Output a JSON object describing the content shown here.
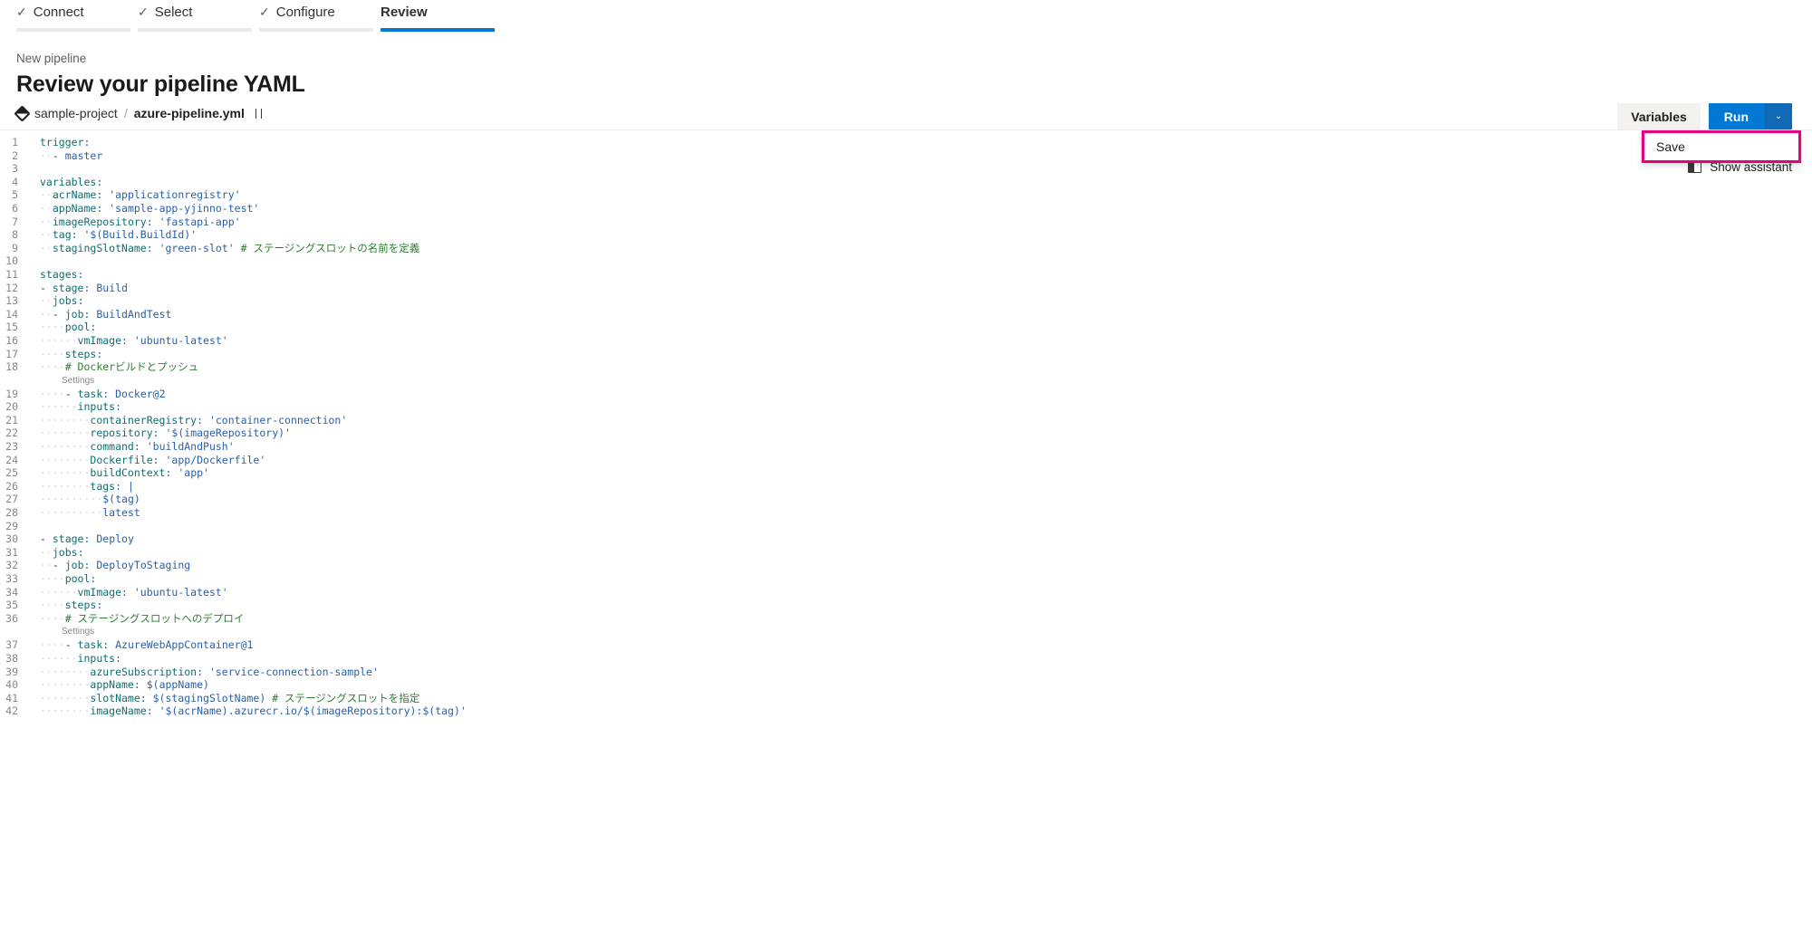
{
  "wizard": {
    "tabs": [
      {
        "label": "Connect",
        "completed": true,
        "active": false,
        "check": "✓"
      },
      {
        "label": "Select",
        "completed": true,
        "active": false,
        "check": "✓"
      },
      {
        "label": "Configure",
        "completed": true,
        "active": false,
        "check": "✓"
      },
      {
        "label": "Review",
        "completed": false,
        "active": true,
        "check": ""
      }
    ]
  },
  "header": {
    "eyebrow": "New pipeline",
    "title": "Review your pipeline YAML"
  },
  "commandbar": {
    "variables_label": "Variables",
    "run_label": "Run",
    "caret_glyph": "⌄",
    "accent_color": "#0078d4"
  },
  "dropdown": {
    "items": [
      {
        "label": "Save"
      }
    ],
    "highlight_color": "#e4007f"
  },
  "assistant": {
    "label": "Show assistant",
    "icon": "panel-icon"
  },
  "breadcrumb": {
    "project": "sample-project",
    "separator": "/",
    "file": "azure-pipeline.yml"
  },
  "editor": {
    "codelens_label": "Settings",
    "lines": [
      {
        "n": 1,
        "segments": [
          {
            "t": "key",
            "s": "trigger"
          },
          {
            "t": "punc",
            "s": ":"
          }
        ]
      },
      {
        "n": 2,
        "segments": [
          {
            "t": "ind",
            "s": "··"
          },
          {
            "t": "dash",
            "s": "- "
          },
          {
            "t": "val",
            "s": "master"
          }
        ]
      },
      {
        "n": 3,
        "segments": []
      },
      {
        "n": 4,
        "segments": [
          {
            "t": "key",
            "s": "variables"
          },
          {
            "t": "punc",
            "s": ":"
          }
        ]
      },
      {
        "n": 5,
        "segments": [
          {
            "t": "ind",
            "s": "··"
          },
          {
            "t": "key",
            "s": "acrName"
          },
          {
            "t": "punc",
            "s": ": "
          },
          {
            "t": "str",
            "s": "'applicationregistry'"
          }
        ]
      },
      {
        "n": 6,
        "segments": [
          {
            "t": "ind",
            "s": "··"
          },
          {
            "t": "key",
            "s": "appName"
          },
          {
            "t": "punc",
            "s": ": "
          },
          {
            "t": "str",
            "s": "'sample-app-yjinno-test'"
          }
        ]
      },
      {
        "n": 7,
        "segments": [
          {
            "t": "ind",
            "s": "··"
          },
          {
            "t": "key",
            "s": "imageRepository"
          },
          {
            "t": "punc",
            "s": ": "
          },
          {
            "t": "str",
            "s": "'fastapi-app'"
          }
        ]
      },
      {
        "n": 8,
        "segments": [
          {
            "t": "ind",
            "s": "··"
          },
          {
            "t": "key",
            "s": "tag"
          },
          {
            "t": "punc",
            "s": ": "
          },
          {
            "t": "str",
            "s": "'$(Build.BuildId)'"
          }
        ]
      },
      {
        "n": 9,
        "segments": [
          {
            "t": "ind",
            "s": "··"
          },
          {
            "t": "key",
            "s": "stagingSlotName"
          },
          {
            "t": "punc",
            "s": ": "
          },
          {
            "t": "str",
            "s": "'green-slot'"
          },
          {
            "t": "cmt",
            "s": " # ステージングスロットの名前を定義"
          }
        ]
      },
      {
        "n": 10,
        "segments": []
      },
      {
        "n": 11,
        "segments": [
          {
            "t": "key",
            "s": "stages"
          },
          {
            "t": "punc",
            "s": ":"
          }
        ]
      },
      {
        "n": 12,
        "segments": [
          {
            "t": "dash",
            "s": "- "
          },
          {
            "t": "key",
            "s": "stage"
          },
          {
            "t": "punc",
            "s": ": "
          },
          {
            "t": "val",
            "s": "Build"
          }
        ]
      },
      {
        "n": 13,
        "segments": [
          {
            "t": "ind",
            "s": "··"
          },
          {
            "t": "key",
            "s": "jobs"
          },
          {
            "t": "punc",
            "s": ":"
          }
        ]
      },
      {
        "n": 14,
        "segments": [
          {
            "t": "ind",
            "s": "··"
          },
          {
            "t": "dash",
            "s": "- "
          },
          {
            "t": "key",
            "s": "job"
          },
          {
            "t": "punc",
            "s": ": "
          },
          {
            "t": "val",
            "s": "BuildAndTest"
          }
        ]
      },
      {
        "n": 15,
        "segments": [
          {
            "t": "ind",
            "s": "····"
          },
          {
            "t": "key",
            "s": "pool"
          },
          {
            "t": "punc",
            "s": ":"
          }
        ]
      },
      {
        "n": 16,
        "segments": [
          {
            "t": "ind",
            "s": "······"
          },
          {
            "t": "key",
            "s": "vmImage"
          },
          {
            "t": "punc",
            "s": ": "
          },
          {
            "t": "str",
            "s": "'ubuntu-latest'"
          }
        ]
      },
      {
        "n": 17,
        "segments": [
          {
            "t": "ind",
            "s": "····"
          },
          {
            "t": "key",
            "s": "steps"
          },
          {
            "t": "punc",
            "s": ":"
          }
        ]
      },
      {
        "n": 18,
        "segments": [
          {
            "t": "ind",
            "s": "····"
          },
          {
            "t": "cmt",
            "s": "# Dockerビルドとプッシュ"
          }
        ],
        "codelens": true
      },
      {
        "n": 19,
        "segments": [
          {
            "t": "ind",
            "s": "····"
          },
          {
            "t": "dash",
            "s": "- "
          },
          {
            "t": "key",
            "s": "task"
          },
          {
            "t": "punc",
            "s": ": "
          },
          {
            "t": "val",
            "s": "Docker@2"
          }
        ]
      },
      {
        "n": 20,
        "segments": [
          {
            "t": "ind",
            "s": "······"
          },
          {
            "t": "key",
            "s": "inputs"
          },
          {
            "t": "punc",
            "s": ":"
          }
        ]
      },
      {
        "n": 21,
        "segments": [
          {
            "t": "ind",
            "s": "········"
          },
          {
            "t": "key",
            "s": "containerRegistry"
          },
          {
            "t": "punc",
            "s": ": "
          },
          {
            "t": "str",
            "s": "'container-connection'"
          }
        ]
      },
      {
        "n": 22,
        "segments": [
          {
            "t": "ind",
            "s": "········"
          },
          {
            "t": "key",
            "s": "repository"
          },
          {
            "t": "punc",
            "s": ": "
          },
          {
            "t": "str",
            "s": "'$(imageRepository)'"
          }
        ]
      },
      {
        "n": 23,
        "segments": [
          {
            "t": "ind",
            "s": "········"
          },
          {
            "t": "key",
            "s": "command"
          },
          {
            "t": "punc",
            "s": ": "
          },
          {
            "t": "str",
            "s": "'buildAndPush'"
          }
        ]
      },
      {
        "n": 24,
        "segments": [
          {
            "t": "ind",
            "s": "········"
          },
          {
            "t": "key",
            "s": "Dockerfile"
          },
          {
            "t": "punc",
            "s": ": "
          },
          {
            "t": "str",
            "s": "'app/Dockerfile'"
          }
        ]
      },
      {
        "n": 25,
        "segments": [
          {
            "t": "ind",
            "s": "········"
          },
          {
            "t": "key",
            "s": "buildContext"
          },
          {
            "t": "punc",
            "s": ": "
          },
          {
            "t": "str",
            "s": "'app'"
          }
        ]
      },
      {
        "n": 26,
        "segments": [
          {
            "t": "ind",
            "s": "········"
          },
          {
            "t": "key",
            "s": "tags"
          },
          {
            "t": "punc",
            "s": ": "
          },
          {
            "t": "val",
            "s": "|"
          }
        ]
      },
      {
        "n": 27,
        "segments": [
          {
            "t": "ind",
            "s": "··········"
          },
          {
            "t": "val",
            "s": "$(tag)"
          }
        ]
      },
      {
        "n": 28,
        "segments": [
          {
            "t": "ind",
            "s": "··········"
          },
          {
            "t": "val",
            "s": "latest"
          }
        ]
      },
      {
        "n": 29,
        "segments": []
      },
      {
        "n": 30,
        "segments": [
          {
            "t": "dash",
            "s": "- "
          },
          {
            "t": "key",
            "s": "stage"
          },
          {
            "t": "punc",
            "s": ": "
          },
          {
            "t": "val",
            "s": "Deploy"
          }
        ]
      },
      {
        "n": 31,
        "segments": [
          {
            "t": "ind",
            "s": "··"
          },
          {
            "t": "key",
            "s": "jobs"
          },
          {
            "t": "punc",
            "s": ":"
          }
        ]
      },
      {
        "n": 32,
        "segments": [
          {
            "t": "ind",
            "s": "··"
          },
          {
            "t": "dash",
            "s": "- "
          },
          {
            "t": "key",
            "s": "job"
          },
          {
            "t": "punc",
            "s": ": "
          },
          {
            "t": "val",
            "s": "DeployToStaging"
          }
        ]
      },
      {
        "n": 33,
        "segments": [
          {
            "t": "ind",
            "s": "····"
          },
          {
            "t": "key",
            "s": "pool"
          },
          {
            "t": "punc",
            "s": ":"
          }
        ]
      },
      {
        "n": 34,
        "segments": [
          {
            "t": "ind",
            "s": "······"
          },
          {
            "t": "key",
            "s": "vmImage"
          },
          {
            "t": "punc",
            "s": ": "
          },
          {
            "t": "str",
            "s": "'ubuntu-latest'"
          }
        ]
      },
      {
        "n": 35,
        "segments": [
          {
            "t": "ind",
            "s": "····"
          },
          {
            "t": "key",
            "s": "steps"
          },
          {
            "t": "punc",
            "s": ":"
          }
        ]
      },
      {
        "n": 36,
        "segments": [
          {
            "t": "ind",
            "s": "····"
          },
          {
            "t": "cmt",
            "s": "# ステージングスロットへのデプロイ"
          }
        ],
        "codelens": true
      },
      {
        "n": 37,
        "segments": [
          {
            "t": "ind",
            "s": "····"
          },
          {
            "t": "dash",
            "s": "- "
          },
          {
            "t": "key",
            "s": "task"
          },
          {
            "t": "punc",
            "s": ": "
          },
          {
            "t": "val",
            "s": "AzureWebAppContainer@1"
          }
        ]
      },
      {
        "n": 38,
        "segments": [
          {
            "t": "ind",
            "s": "······"
          },
          {
            "t": "key",
            "s": "inputs"
          },
          {
            "t": "punc",
            "s": ":"
          }
        ]
      },
      {
        "n": 39,
        "segments": [
          {
            "t": "ind",
            "s": "········"
          },
          {
            "t": "key",
            "s": "azureSubscription"
          },
          {
            "t": "punc",
            "s": ": "
          },
          {
            "t": "str",
            "s": "'service-connection-sample'"
          }
        ]
      },
      {
        "n": 40,
        "segments": [
          {
            "t": "ind",
            "s": "········"
          },
          {
            "t": "key",
            "s": "appName"
          },
          {
            "t": "punc",
            "s": ": "
          },
          {
            "t": "val",
            "s": "$(appName)"
          }
        ]
      },
      {
        "n": 41,
        "segments": [
          {
            "t": "ind",
            "s": "········"
          },
          {
            "t": "key",
            "s": "slotName"
          },
          {
            "t": "punc",
            "s": ": "
          },
          {
            "t": "val",
            "s": "$(stagingSlotName)"
          },
          {
            "t": "cmt",
            "s": " # ステージングスロットを指定"
          }
        ]
      },
      {
        "n": 42,
        "segments": [
          {
            "t": "ind",
            "s": "········"
          },
          {
            "t": "key",
            "s": "imageName"
          },
          {
            "t": "punc",
            "s": ": "
          },
          {
            "t": "str",
            "s": "'$(acrName).azurecr.io/$(imageRepository):$(tag)'"
          }
        ]
      }
    ]
  }
}
